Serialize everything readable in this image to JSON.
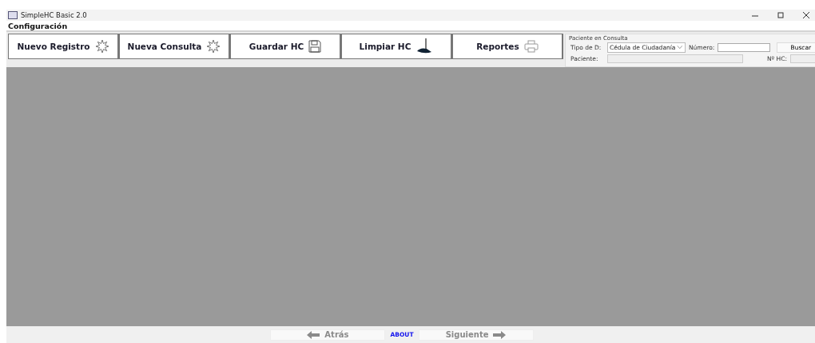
{
  "window": {
    "title": "SimpleHC Basic 2.0"
  },
  "menu": [
    "Configuración"
  ],
  "toolbar": [
    {
      "label": "Nuevo Registro",
      "kind": "new"
    },
    {
      "label": "Nueva Consulta",
      "kind": "new"
    },
    {
      "label": "Guardar HC",
      "kind": "save"
    },
    {
      "label": "Limpiar HC",
      "kind": "clear"
    },
    {
      "label": "Reportes",
      "kind": "print"
    }
  ],
  "patient_panel": {
    "title": "Paciente en Consulta",
    "doc_type_label": "Tipo de D:",
    "doc_type_value": "Cédula de Ciudadanía",
    "number_label": "Número:",
    "search_button": "Buscar",
    "patient_label": "Paciente:",
    "hc_label": "Nº HC:"
  },
  "footer": [
    {
      "kind": "back",
      "label": "Atrás",
      "disabled": true
    },
    {
      "kind": "link",
      "label": "ABOUT",
      "disabled": false
    },
    {
      "kind": "next",
      "label": "Siguiente",
      "disabled": true
    }
  ]
}
